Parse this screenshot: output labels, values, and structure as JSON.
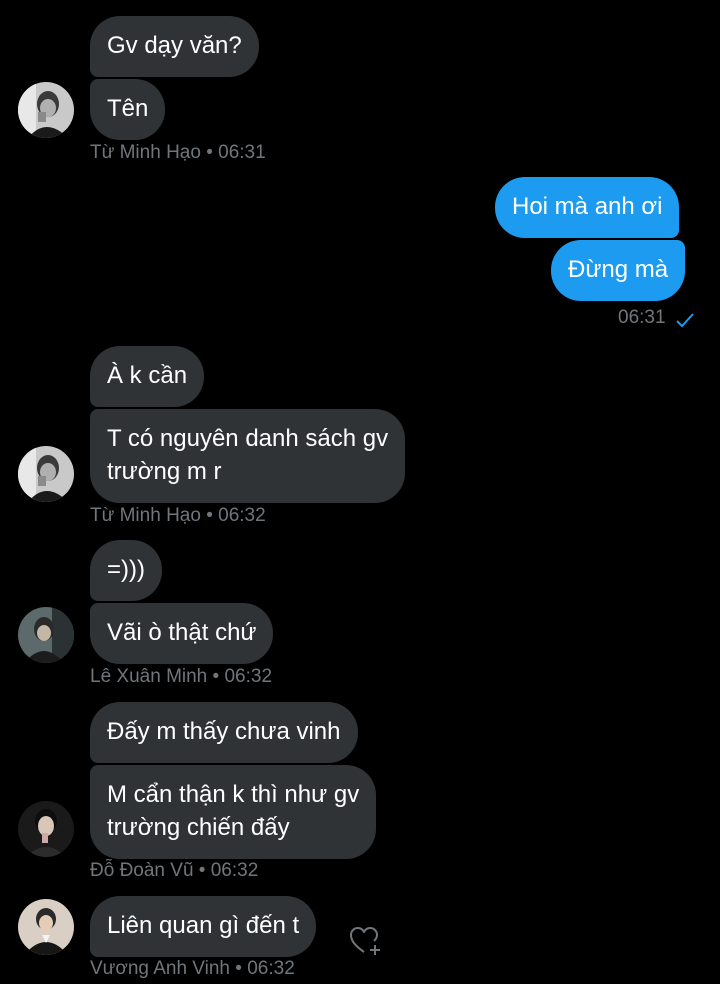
{
  "colors": {
    "background": "#000000",
    "incoming_bubble": "#2f3336",
    "outgoing_bubble": "#1d9bf0",
    "meta_text": "#71767b",
    "check": "#1d9bf0"
  },
  "messages": [
    {
      "text": "Gv dạy văn?"
    },
    {
      "text": "Tên"
    },
    {
      "text": "Hoi mà anh ơi"
    },
    {
      "text": "Đừng mà"
    },
    {
      "text": "À k cần"
    },
    {
      "text": "T có nguyên danh sách gv"
    },
    {
      "text": "trường m r"
    },
    {
      "text": "=)))"
    },
    {
      "text": "Vãi ò thật chứ"
    },
    {
      "text": "Đấy m thấy chưa vinh"
    },
    {
      "text": "M cẩn thận k thì như gv"
    },
    {
      "text": "trường chiến đấy"
    },
    {
      "text": "Liên quan gì đến t"
    }
  ],
  "meta": [
    {
      "sender": "Từ Minh Hạo",
      "time": "06:31"
    },
    {
      "time": "06:31"
    },
    {
      "sender": "Từ Minh Hạo",
      "time": "06:32"
    },
    {
      "sender": "Lê Xuân Minh",
      "time": "06:32"
    },
    {
      "sender": "Đỗ Đoàn Vũ",
      "time": "06:32"
    },
    {
      "sender": "Vương Anh Vinh",
      "time": "06:32"
    }
  ],
  "separator": "•",
  "icons": {
    "read_receipt": "check-icon",
    "add_reaction": "heart-plus-icon"
  }
}
